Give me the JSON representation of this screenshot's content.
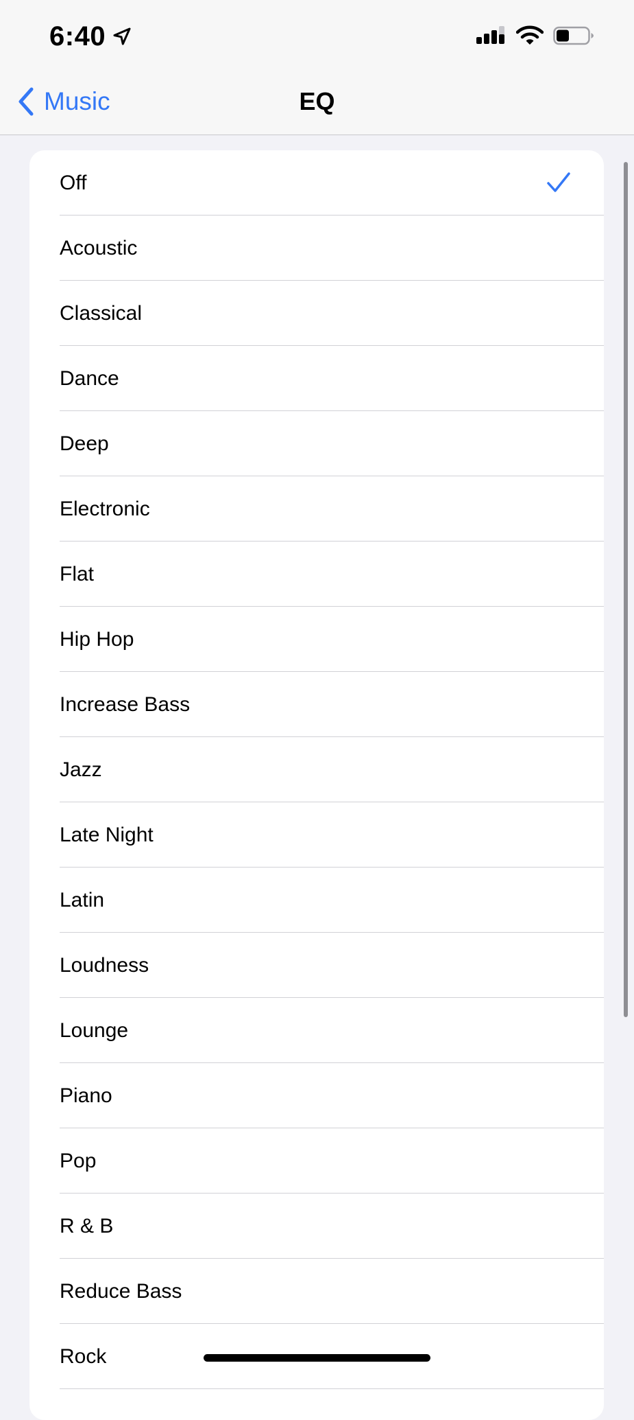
{
  "status_bar": {
    "time": "6:40",
    "icons": [
      "location-arrow-icon",
      "cellular-signal-icon",
      "wifi-icon",
      "battery-icon"
    ]
  },
  "nav": {
    "back_label": "Music",
    "title": "EQ"
  },
  "eq_list": {
    "selected": "Off",
    "items": [
      "Off",
      "Acoustic",
      "Classical",
      "Dance",
      "Deep",
      "Electronic",
      "Flat",
      "Hip Hop",
      "Increase Bass",
      "Jazz",
      "Late Night",
      "Latin",
      "Loudness",
      "Lounge",
      "Piano",
      "Pop",
      "R & B",
      "Reduce Bass",
      "Rock"
    ]
  },
  "colors": {
    "accent": "#3478f6",
    "background": "#f2f2f7",
    "card": "#ffffff",
    "separator": "#d1d1d6"
  }
}
